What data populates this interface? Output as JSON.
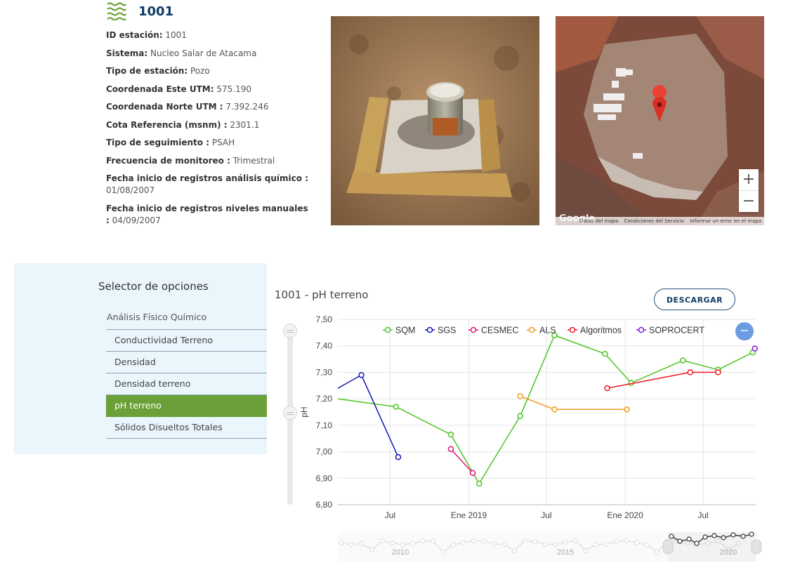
{
  "station": {
    "id": "1001",
    "fields": [
      {
        "label": "ID estación:",
        "value": "1001"
      },
      {
        "label": "Sistema:",
        "value": "Nucleo Salar de Atacama"
      },
      {
        "label": "Tipo de estación:",
        "value": "Pozo"
      },
      {
        "label": "Coordenada Este UTM:",
        "value": "575.190"
      },
      {
        "label": "Coordenada Norte UTM :",
        "value": "7.392.246"
      },
      {
        "label": "Cota Referencia (msnm) :",
        "value": "2301.1"
      },
      {
        "label": "Tipo de seguimiento :",
        "value": "PSAH"
      },
      {
        "label": "Frecuencia de monitoreo :",
        "value": "Trimestral"
      },
      {
        "label": "Fecha inicio de registros análisis químico :",
        "value": "01/08/2007"
      },
      {
        "label": "Fecha inicio de registros niveles manuales :",
        "value": "04/09/2007"
      }
    ]
  },
  "map": {
    "zoom_in": "+",
    "zoom_out": "−",
    "brand": "Google",
    "footer": [
      "Datos del mapa",
      "Condiciones del Servicio",
      "Informar un error en el mapa"
    ]
  },
  "selector": {
    "title": "Selector de opciones",
    "group": "Análisis Físico Químico",
    "items": [
      "Conductividad Terreno",
      "Densidad",
      "Densidad terreno",
      "pH terreno",
      "Sólidos Disueltos Totales"
    ],
    "active": "pH terreno"
  },
  "chart": {
    "title": "1001 - pH terreno",
    "download_label": "DESCARGAR",
    "minus_label": "−",
    "navigator_labels": [
      "2010",
      "2015",
      "2020"
    ]
  },
  "colors": {
    "accent": "#6aa037",
    "brand": "#0d3b66",
    "selector_bg": "#eaf6fc"
  },
  "chart_data": {
    "type": "line",
    "ylabel": "pH",
    "xlabel": "",
    "ylim": [
      6.8,
      7.5
    ],
    "yticks": [
      "6,80",
      "6,90",
      "7,00",
      "7,10",
      "7,20",
      "7,30",
      "7,40",
      "7,50"
    ],
    "x_range": [
      "2018-03-01",
      "2020-11-01"
    ],
    "xticks": [
      {
        "date": "2018-07-01",
        "label": "Jul"
      },
      {
        "date": "2019-01-01",
        "label": "Ene 2019"
      },
      {
        "date": "2019-07-01",
        "label": "Jul"
      },
      {
        "date": "2020-01-01",
        "label": "Ene 2020"
      },
      {
        "date": "2020-07-01",
        "label": "Jul"
      }
    ],
    "legend_position": "top",
    "series": [
      {
        "name": "SQM",
        "color": "#4cc421",
        "points": [
          [
            "2018-03-01",
            7.2
          ],
          [
            "2018-07-15",
            7.17
          ],
          [
            "2018-11-20",
            7.065
          ],
          [
            "2019-01-25",
            6.88
          ],
          [
            "2019-05-01",
            7.135
          ],
          [
            "2019-07-20",
            7.44
          ],
          [
            "2019-11-15",
            7.37
          ],
          [
            "2020-01-15",
            7.26
          ],
          [
            "2020-05-15",
            7.345
          ],
          [
            "2020-08-05",
            7.31
          ],
          [
            "2020-10-25",
            7.375
          ]
        ]
      },
      {
        "name": "SGS",
        "color": "#1216b8",
        "points": [
          [
            "2018-03-01",
            7.24
          ],
          [
            "2018-04-25",
            7.29
          ],
          [
            "2018-07-20",
            6.98
          ]
        ]
      },
      {
        "name": "CESMEC",
        "color": "#e0147a",
        "points": [
          [
            "2018-11-20",
            7.01
          ],
          [
            "2019-01-10",
            6.92
          ]
        ]
      },
      {
        "name": "ALS",
        "color": "#f59b1b",
        "points": [
          [
            "2019-05-01",
            7.21
          ],
          [
            "2019-07-20",
            7.16
          ],
          [
            "2020-01-05",
            7.16
          ]
        ]
      },
      {
        "name": "Algoritmos",
        "color": "#f2141d",
        "points": [
          [
            "2019-11-20",
            7.24
          ],
          [
            "2020-06-01",
            7.3
          ],
          [
            "2020-08-05",
            7.3
          ]
        ]
      },
      {
        "name": "SOPROCERT",
        "color": "#7f17e8",
        "points": [
          [
            "2020-10-30",
            7.39
          ]
        ]
      }
    ]
  }
}
